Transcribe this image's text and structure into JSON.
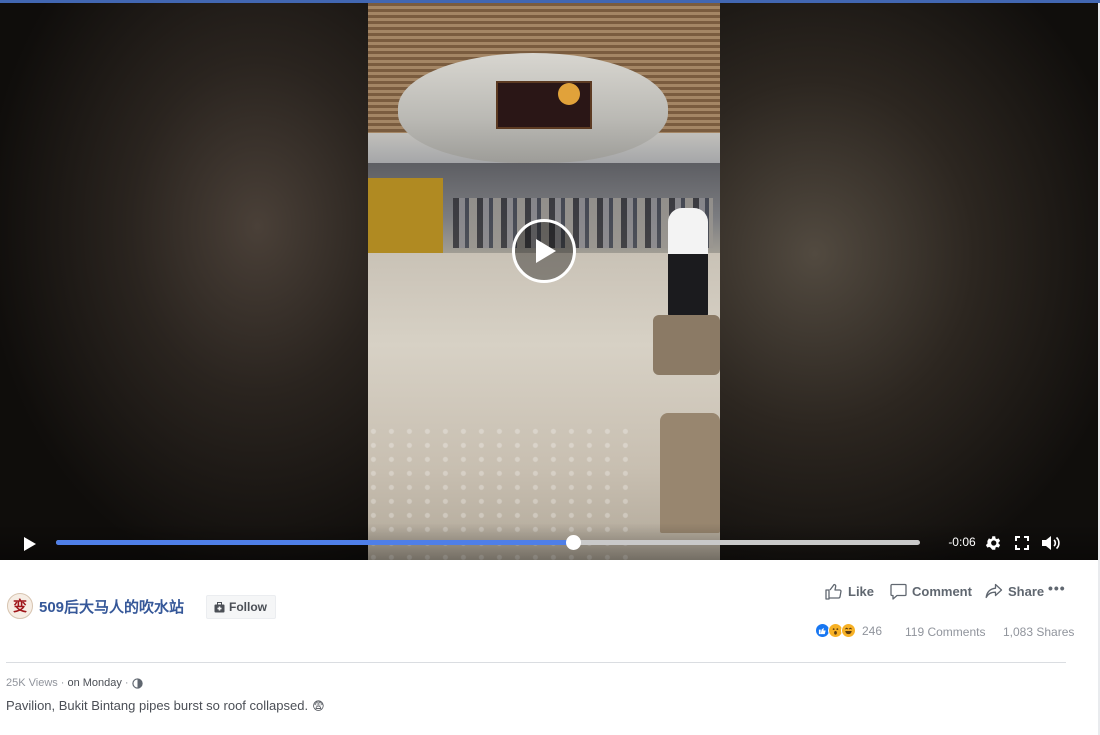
{
  "player": {
    "remaining_time": "-0:06",
    "progress_fraction": 0.598,
    "accent_color": "#4f7fe8"
  },
  "post": {
    "page_name": "509后大马人的吹水站",
    "avatar_glyph": "变",
    "follow_label": "Follow",
    "actions": {
      "like": "Like",
      "comment": "Comment",
      "share": "Share",
      "more": "•••"
    },
    "reaction_count": "246",
    "comments_count": "119 Comments",
    "shares_count": "1,083 Shares",
    "views": "25K Views",
    "separator": "·",
    "posted": "on Monday",
    "privacy_icon": "globe-icon",
    "caption": "Pavilion, Bukit Bintang pipes burst so roof collapsed.",
    "caption_emoji": "😨"
  },
  "colors": {
    "link_blue": "#365899",
    "top_bar": "#4267b2"
  }
}
